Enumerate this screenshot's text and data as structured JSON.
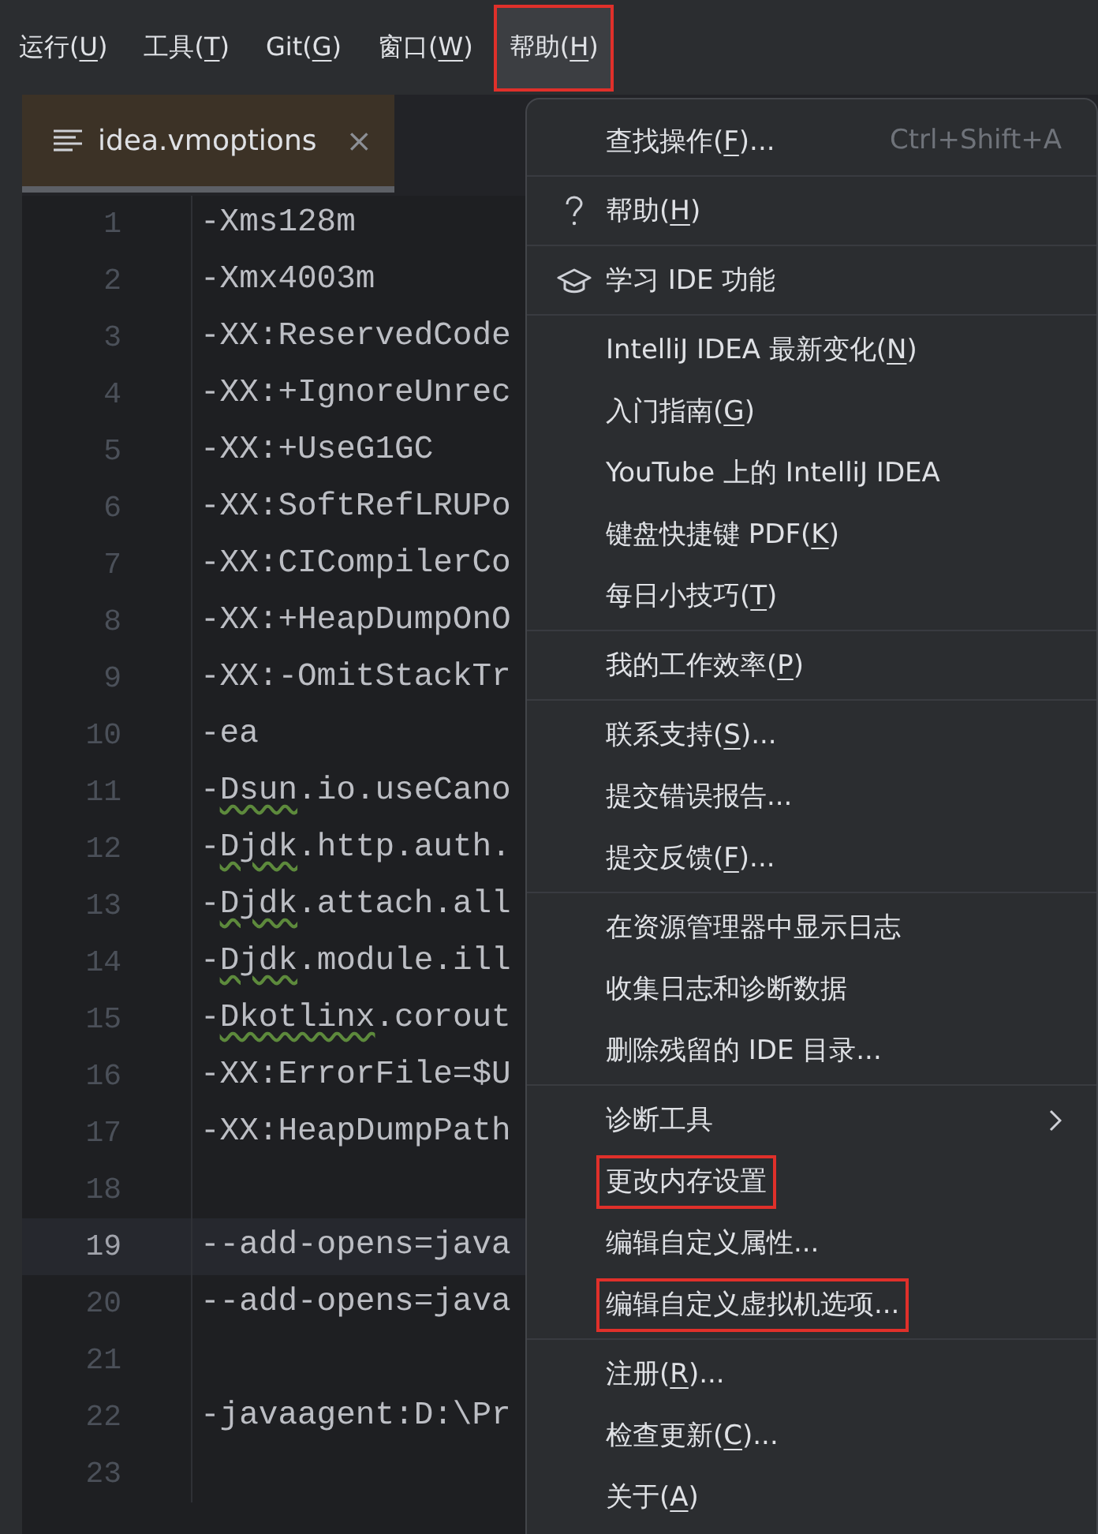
{
  "menu_bar": [
    {
      "label": "运行(",
      "mnemonic": "U",
      "label_end": ")",
      "selected": false,
      "highlighted": false
    },
    {
      "label": "工具(",
      "mnemonic": "T",
      "label_end": ")",
      "selected": false,
      "highlighted": false
    },
    {
      "label": "Git(",
      "mnemonic": "G",
      "label_end": ")",
      "selected": false,
      "highlighted": false
    },
    {
      "label": "窗口(",
      "mnemonic": "W",
      "label_end": ")",
      "selected": false,
      "highlighted": false
    },
    {
      "label": "帮助(",
      "mnemonic": "H",
      "label_end": ")",
      "selected": true,
      "highlighted": true
    }
  ],
  "editor": {
    "tab": {
      "title": "idea.vmoptions",
      "close": "×"
    },
    "lines": [
      {
        "number": "1",
        "current": false,
        "code": [
          {
            "text": "-Xms128m",
            "typo": false
          }
        ]
      },
      {
        "number": "2",
        "current": false,
        "code": [
          {
            "text": "-Xmx4003m",
            "typo": false
          }
        ]
      },
      {
        "number": "3",
        "current": false,
        "code": [
          {
            "text": "-XX:ReservedCode",
            "typo": false
          }
        ]
      },
      {
        "number": "4",
        "current": false,
        "code": [
          {
            "text": "-XX:+IgnoreUnrec",
            "typo": false
          }
        ]
      },
      {
        "number": "5",
        "current": false,
        "code": [
          {
            "text": "-XX:+UseG1GC",
            "typo": false
          }
        ]
      },
      {
        "number": "6",
        "current": false,
        "code": [
          {
            "text": "-XX:SoftRefLRUPo",
            "typo": false
          }
        ]
      },
      {
        "number": "7",
        "current": false,
        "code": [
          {
            "text": "-XX:CICompilerCo",
            "typo": false
          }
        ]
      },
      {
        "number": "8",
        "current": false,
        "code": [
          {
            "text": "-XX:+HeapDumpOnO",
            "typo": false
          }
        ]
      },
      {
        "number": "9",
        "current": false,
        "code": [
          {
            "text": "-XX:-OmitStackTr",
            "typo": false
          }
        ]
      },
      {
        "number": "10",
        "current": false,
        "code": [
          {
            "text": "-ea",
            "typo": false
          }
        ]
      },
      {
        "number": "11",
        "current": false,
        "code": [
          {
            "text": "-",
            "typo": false
          },
          {
            "text": "Dsun",
            "typo": true
          },
          {
            "text": ".io.useCano",
            "typo": false
          }
        ]
      },
      {
        "number": "12",
        "current": false,
        "code": [
          {
            "text": "-",
            "typo": false
          },
          {
            "text": "Djdk",
            "typo": true
          },
          {
            "text": ".http.auth.",
            "typo": false
          }
        ]
      },
      {
        "number": "13",
        "current": false,
        "code": [
          {
            "text": "-",
            "typo": false
          },
          {
            "text": "Djdk",
            "typo": true
          },
          {
            "text": ".attach.all",
            "typo": false
          }
        ]
      },
      {
        "number": "14",
        "current": false,
        "code": [
          {
            "text": "-",
            "typo": false
          },
          {
            "text": "Djdk",
            "typo": true
          },
          {
            "text": ".module.ill",
            "typo": false
          }
        ]
      },
      {
        "number": "15",
        "current": false,
        "code": [
          {
            "text": "-",
            "typo": false
          },
          {
            "text": "Dkotlinx",
            "typo": true
          },
          {
            "text": ".corout",
            "typo": false
          }
        ]
      },
      {
        "number": "16",
        "current": false,
        "code": [
          {
            "text": "-XX:ErrorFile=$U",
            "typo": false
          }
        ]
      },
      {
        "number": "17",
        "current": false,
        "code": [
          {
            "text": "-XX:HeapDumpPath",
            "typo": false
          }
        ]
      },
      {
        "number": "18",
        "current": false
      },
      {
        "number": "19",
        "current": true,
        "code": [
          {
            "text": "--add-opens=java",
            "typo": false
          }
        ]
      },
      {
        "number": "20",
        "current": false,
        "code": [
          {
            "text": "--add-opens=java",
            "typo": false
          }
        ]
      },
      {
        "number": "21",
        "current": false
      },
      {
        "number": "22",
        "current": false,
        "code": [
          {
            "text": "-javaagent:D:\\Pr",
            "typo": false
          }
        ]
      },
      {
        "number": "23",
        "current": false
      }
    ]
  },
  "help_menu": {
    "groups": [
      [
        {
          "kind": "plain",
          "label": "查找操作(",
          "mnemonic": "F",
          "label_end": ")...",
          "shortcut": "Ctrl+Shift+A",
          "highlighted": false
        }
      ],
      [
        {
          "kind": "help",
          "label": "帮助(",
          "mnemonic": "H",
          "label_end": ")",
          "highlighted": false
        }
      ],
      [
        {
          "kind": "learn",
          "label": "学习 IDE 功能",
          "highlighted": false
        }
      ],
      [
        {
          "kind": "plain",
          "label": "IntelliJ IDEA 最新变化(",
          "mnemonic": "N",
          "label_end": ")",
          "highlighted": false
        },
        {
          "kind": "plain",
          "label": "入门指南(",
          "mnemonic": "G",
          "label_end": ")",
          "highlighted": false
        },
        {
          "kind": "plain",
          "label": "YouTube 上的 IntelliJ IDEA",
          "highlighted": false
        },
        {
          "kind": "plain",
          "label": "键盘快捷键 PDF(",
          "mnemonic": "K",
          "label_end": ")",
          "highlighted": false
        },
        {
          "kind": "plain",
          "label": "每日小技巧(",
          "mnemonic": "T",
          "label_end": ")",
          "highlighted": false
        }
      ],
      [
        {
          "kind": "plain",
          "label": "我的工作效率(",
          "mnemonic": "P",
          "label_end": ")",
          "highlighted": false
        }
      ],
      [
        {
          "kind": "plain",
          "label": "联系支持(",
          "mnemonic": "S",
          "label_end": ")...",
          "highlighted": false
        },
        {
          "kind": "plain",
          "label": "提交错误报告...",
          "highlighted": false
        },
        {
          "kind": "plain",
          "label": "提交反馈(",
          "mnemonic": "F",
          "label_end": ")...",
          "highlighted": false
        }
      ],
      [
        {
          "kind": "plain",
          "label": "在资源管理器中显示日志",
          "highlighted": false
        },
        {
          "kind": "plain",
          "label": "收集日志和诊断数据",
          "highlighted": false
        },
        {
          "kind": "plain",
          "label": "删除残留的 IDE 目录...",
          "highlighted": false
        }
      ],
      [
        {
          "kind": "submenu",
          "label": "诊断工具",
          "highlighted": false
        },
        {
          "kind": "plain",
          "label": "更改内存设置",
          "highlighted": true
        },
        {
          "kind": "plain",
          "label": "编辑自定义属性...",
          "highlighted": false
        },
        {
          "kind": "plain",
          "label": "编辑自定义虚拟机选项...",
          "highlighted": true
        }
      ],
      [
        {
          "kind": "plain",
          "label": "注册(",
          "mnemonic": "R",
          "label_end": ")...",
          "highlighted": false
        },
        {
          "kind": "plain",
          "label": "检查更新(",
          "mnemonic": "C",
          "label_end": ")...",
          "highlighted": false
        },
        {
          "kind": "plain",
          "label": "关于(",
          "mnemonic": "A",
          "label_end": ")",
          "highlighted": false
        }
      ]
    ]
  }
}
